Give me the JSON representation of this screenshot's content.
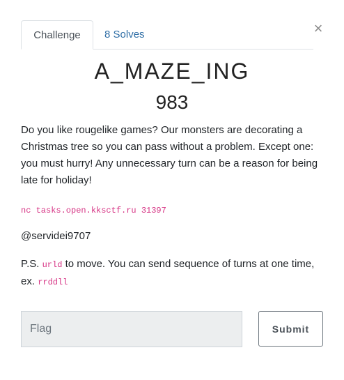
{
  "tabs": {
    "challenge": "Challenge",
    "solves": "8 Solves"
  },
  "close_icon": "close-icon",
  "challenge": {
    "name": "A_MAZE_ING",
    "value": "983",
    "description_1": "Do you like rougelike games? Our monsters are decorating a Christmas tree so you can pass without a problem. Except one: you must hurry! Any unnecessary turn can be a reason for being late for holiday!",
    "connection": "nc tasks.open.kksctf.ru 31397",
    "author": "@servidei9707",
    "ps_prefix": "P.S. ",
    "ps_code_1": "urld",
    "ps_middle": " to move. You can send sequence of turns at one time, ex. ",
    "ps_code_2": "rrddll"
  },
  "form": {
    "flag_placeholder": "Flag",
    "submit_label": "Submit"
  }
}
